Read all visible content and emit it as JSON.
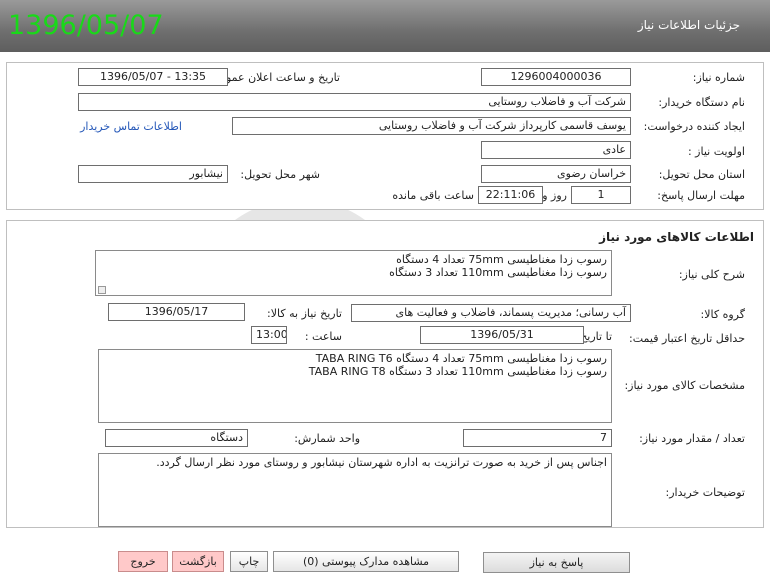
{
  "header": {
    "title": "جزئیات اطلاعات نیاز",
    "date": "1396/05/07"
  },
  "need": {
    "number_label": "شماره نیاز:",
    "number": "1296004000036",
    "announce_label": "تاریخ و ساعت اعلان عمومی:",
    "announce": "1396/05/07 - 13:35",
    "buyer_label": "نام دستگاه خریدار:",
    "buyer": "شرکت آب و فاضلاب روستایی",
    "creator_label": "ایجاد کننده درخواست:",
    "creator": "یوسف  قاسمی کارپرداز شرکت آب و فاضلاب روستایی",
    "contact_link": "اطلاعات تماس خریدار",
    "priority_label": "اولویت نیاز :",
    "priority": "عادی",
    "province_label": "استان محل تحویل:",
    "province": "خراسان رضوی",
    "city_label": "شهر محل تحویل:",
    "city": "نیشابور",
    "deadline_label": "مهلت ارسال پاسخ:",
    "days": "1",
    "days_label": "روز و",
    "time": "22:11:06",
    "time_label": "ساعت باقی مانده"
  },
  "goods": {
    "section_title": "اطلاعات کالاهای مورد نیاز",
    "general_label": "شرح کلی نیاز:",
    "general_lines": [
      "رسوب زدا مغناطیسی 75mm تعداد 4 دستگاه",
      "رسوب زدا مغناطیسی 110mm  تعداد 3 دستگاه"
    ],
    "group_label": "گروه کالا:",
    "group": "آب رسانی؛ مدیریت پسماند، فاضلاب و فعالیت های",
    "need_date_label": "تاریخ نیاز به کالا:",
    "need_date": "1396/05/17",
    "min_validity_label": "حداقل تاریخ اعتبار قیمت:",
    "to_date_label": "تا تاریخ :",
    "to_date": "1396/05/31",
    "hour_label": "ساعت :",
    "hour": "13:00",
    "spec_label": "مشخصات کالای مورد نیاز:",
    "spec_lines": [
      "رسوب زدا مغناطیسی 75mm تعداد 4 دستگاه  TABA RING T6",
      "رسوب زدا مغناطیسی 110mm  تعداد 3 دستگاه TABA RING T8"
    ],
    "qty_label": "تعداد / مقدار مورد نیاز:",
    "qty": "7",
    "unit_label": "واحد شمارش:",
    "unit": "دستگاه",
    "notes_label": "توضیحات خریدار:",
    "notes": "اجناس پس از خرید به صورت ترانزیت به اداره شهرستان نیشابور  و روستای مورد نظر ارسال گردد."
  },
  "buttons": {
    "reply": "پاسخ به نیاز",
    "attachments": "مشاهده مدارک پیوستی (0)",
    "print": "چاپ",
    "back": "بازگشت",
    "exit": "خروج"
  },
  "colors": {
    "date_green": "#19d919",
    "exit_pink": "#ffc9c9",
    "link_blue": "#2457b8"
  }
}
